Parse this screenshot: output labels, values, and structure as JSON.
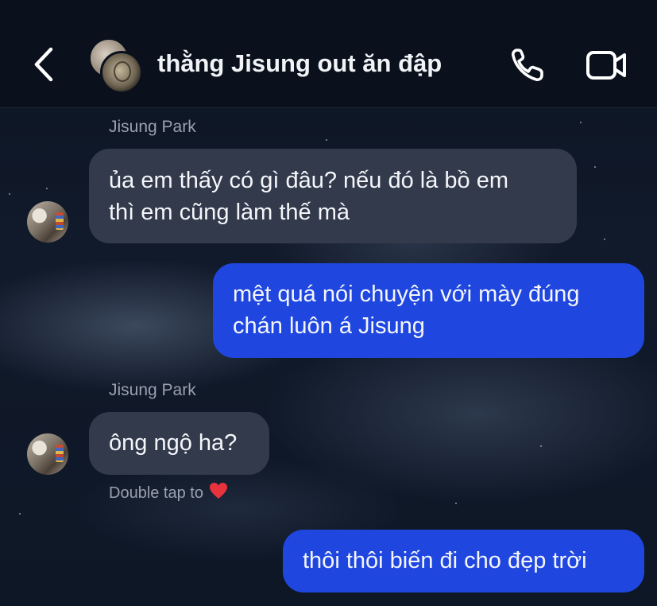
{
  "header": {
    "title": "thằng Jisung out ăn đập",
    "back_icon": "chevron-left-icon",
    "call_icon": "phone-icon",
    "video_icon": "video-camera-icon"
  },
  "messages": [
    {
      "direction": "incoming",
      "sender": "Jisung Park",
      "lines": [
        "ủa em thấy có gì đâu? nếu đó là bồ em",
        "thì em cũng làm thế mà"
      ]
    },
    {
      "direction": "outgoing",
      "lines": [
        "mệt quá nói chuyện với mày đúng",
        "chán luôn á Jisung"
      ]
    },
    {
      "direction": "incoming",
      "sender": "Jisung Park",
      "lines": [
        "ông ngộ ha?"
      ]
    },
    {
      "direction": "outgoing",
      "lines": [
        "thôi thôi biến đi cho đẹp trời"
      ]
    }
  ],
  "reaction_hint": "Double tap to",
  "colors": {
    "background": "#0d1524",
    "header": "#0a111c",
    "incoming_bubble": "#323a4b",
    "outgoing_bubble": "#1f47e0",
    "heart": "#e8323c"
  }
}
